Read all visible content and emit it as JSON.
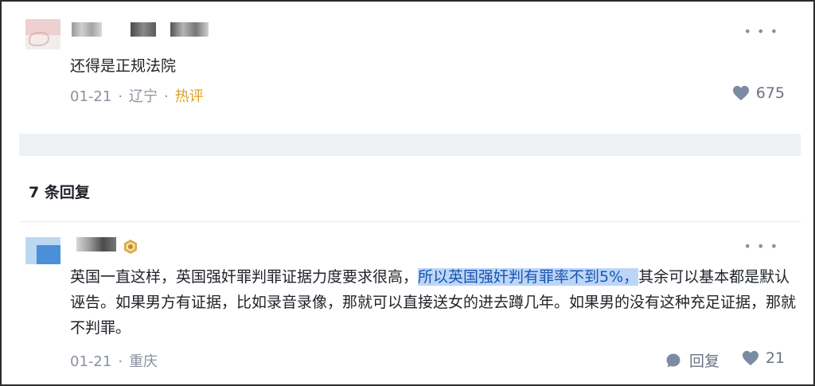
{
  "comment": {
    "text": "还得是正规法院",
    "date": "01-21",
    "location": "辽宁",
    "tag": "热评",
    "likes": "675",
    "more_icon": "more-icon",
    "like_icon": "heart-icon"
  },
  "replies_header": "7 条回复",
  "reply": {
    "text_before": "英国一直这样，英国强奸罪判罪证据力度要求很高，",
    "text_highlight": "所以英国强奸判有罪率不到5%，",
    "text_after": "其余可以基本都是默认诬告。如果男方有证据，比如录音录像，那就可以直接送女的进去蹲几年。如果男的没有这种充足证据，那就不判罪。",
    "date": "01-21",
    "location": "重庆",
    "reply_label": "回复",
    "likes": "21",
    "badge_icon": "level-badge-icon"
  },
  "colors": {
    "highlight_bg": "#bcd6f7",
    "hot_tag": "#e0a020",
    "band": "#eef1f4"
  }
}
